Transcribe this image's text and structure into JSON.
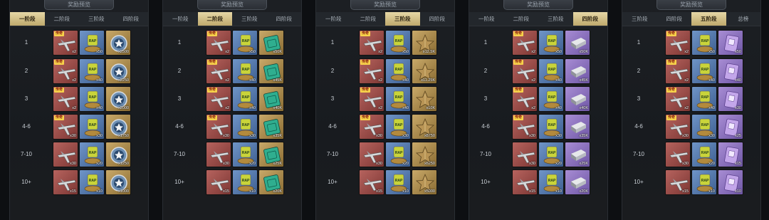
{
  "panels": [
    {
      "title": "奖励预览",
      "tabs": [
        {
          "label": "一阶段",
          "active": true
        },
        {
          "label": "二阶段",
          "active": false
        },
        {
          "label": "三阶段",
          "active": false
        },
        {
          "label": "四阶段",
          "active": false
        }
      ],
      "rows": [
        {
          "tier": "1",
          "items": [
            {
              "type": "plane",
              "quality": "red",
              "badge": "传奇",
              "count": "x2"
            },
            {
              "type": "rations",
              "quality": "blue",
              "count": "x50"
            },
            {
              "type": "medal",
              "quality": "gold",
              "count": "x2500"
            }
          ]
        },
        {
          "tier": "2",
          "items": [
            {
              "type": "plane",
              "quality": "red",
              "badge": "传奇",
              "count": "x2"
            },
            {
              "type": "rations",
              "quality": "blue",
              "count": "x40"
            },
            {
              "type": "medal",
              "quality": "gold",
              "count": "x2250"
            }
          ]
        },
        {
          "tier": "3",
          "items": [
            {
              "type": "plane",
              "quality": "red",
              "badge": "传奇",
              "count": "x2"
            },
            {
              "type": "rations",
              "quality": "blue",
              "count": "x40"
            },
            {
              "type": "medal",
              "quality": "gold",
              "count": "x2000"
            }
          ]
        },
        {
          "tier": "4-6",
          "items": [
            {
              "type": "plane",
              "quality": "red",
              "badge": "传奇",
              "count": "x30"
            },
            {
              "type": "rations",
              "quality": "blue",
              "count": "x30"
            },
            {
              "type": "medal",
              "quality": "gold",
              "count": "x1750"
            }
          ]
        },
        {
          "tier": "7-10",
          "items": [
            {
              "type": "plane",
              "quality": "red",
              "count": "x30"
            },
            {
              "type": "rations",
              "quality": "blue",
              "count": "x20"
            },
            {
              "type": "medal",
              "quality": "gold",
              "count": "x1250"
            }
          ]
        },
        {
          "tier": "10+",
          "items": [
            {
              "type": "plane",
              "quality": "red",
              "count": "x15"
            },
            {
              "type": "rations",
              "quality": "blue",
              "count": "x10"
            },
            {
              "type": "medal",
              "quality": "gold",
              "count": "x1000"
            }
          ]
        }
      ]
    },
    {
      "title": "奖励预览",
      "tabs": [
        {
          "label": "一阶段",
          "active": false
        },
        {
          "label": "二阶段",
          "active": true
        },
        {
          "label": "三阶段",
          "active": false
        },
        {
          "label": "四阶段",
          "active": false
        }
      ],
      "rows": [
        {
          "tier": "1",
          "items": [
            {
              "type": "plane",
              "quality": "red",
              "badge": "传奇",
              "count": "x2"
            },
            {
              "type": "rations",
              "quality": "blue",
              "count": "x50"
            },
            {
              "type": "manual",
              "quality": "gold",
              "count": "x50K"
            }
          ]
        },
        {
          "tier": "2",
          "items": [
            {
              "type": "plane",
              "quality": "red",
              "badge": "传奇",
              "count": "x2"
            },
            {
              "type": "rations",
              "quality": "blue",
              "count": "x40"
            },
            {
              "type": "manual",
              "quality": "gold",
              "count": "x45K"
            }
          ]
        },
        {
          "tier": "3",
          "items": [
            {
              "type": "plane",
              "quality": "red",
              "badge": "传奇",
              "count": "x2"
            },
            {
              "type": "rations",
              "quality": "blue",
              "count": "x40"
            },
            {
              "type": "manual",
              "quality": "gold",
              "count": "x40K"
            }
          ]
        },
        {
          "tier": "4-6",
          "items": [
            {
              "type": "plane",
              "quality": "red",
              "badge": "传奇",
              "count": "x30"
            },
            {
              "type": "rations",
              "quality": "blue",
              "count": "x30"
            },
            {
              "type": "manual",
              "quality": "gold",
              "count": "x35K"
            }
          ]
        },
        {
          "tier": "7-10",
          "items": [
            {
              "type": "plane",
              "quality": "red",
              "count": "x30"
            },
            {
              "type": "rations",
              "quality": "blue",
              "count": "x20"
            },
            {
              "type": "manual",
              "quality": "gold",
              "count": "x25K"
            }
          ]
        },
        {
          "tier": "10+",
          "items": [
            {
              "type": "plane",
              "quality": "red",
              "count": "x15"
            },
            {
              "type": "rations",
              "quality": "blue",
              "count": "x10"
            },
            {
              "type": "manual",
              "quality": "gold",
              "count": "x20K"
            }
          ]
        }
      ]
    },
    {
      "title": "奖励预览",
      "tabs": [
        {
          "label": "一阶段",
          "active": false
        },
        {
          "label": "二阶段",
          "active": false
        },
        {
          "label": "三阶段",
          "active": true
        },
        {
          "label": "四阶段",
          "active": false
        }
      ],
      "rows": [
        {
          "tier": "1",
          "items": [
            {
              "type": "plane",
              "quality": "red",
              "badge": "传奇",
              "count": "x2"
            },
            {
              "type": "rations",
              "quality": "blue",
              "count": "x50"
            },
            {
              "type": "star",
              "quality": "gold",
              "count": "x12.5K"
            }
          ]
        },
        {
          "tier": "2",
          "items": [
            {
              "type": "plane",
              "quality": "red",
              "badge": "传奇",
              "count": "x2"
            },
            {
              "type": "rations",
              "quality": "blue",
              "count": "x40"
            },
            {
              "type": "star",
              "quality": "gold",
              "count": "x11.25K"
            }
          ]
        },
        {
          "tier": "3",
          "items": [
            {
              "type": "plane",
              "quality": "red",
              "badge": "传奇",
              "count": "x2"
            },
            {
              "type": "rations",
              "quality": "blue",
              "count": "x40"
            },
            {
              "type": "star",
              "quality": "gold",
              "count": "x10K"
            }
          ]
        },
        {
          "tier": "4-6",
          "items": [
            {
              "type": "plane",
              "quality": "red",
              "badge": "传奇",
              "count": "x30"
            },
            {
              "type": "rations",
              "quality": "blue",
              "count": "x30"
            },
            {
              "type": "star",
              "quality": "gold",
              "count": "x8750"
            }
          ]
        },
        {
          "tier": "7-10",
          "items": [
            {
              "type": "plane",
              "quality": "red",
              "count": "x30"
            },
            {
              "type": "rations",
              "quality": "blue",
              "count": "x20"
            },
            {
              "type": "star",
              "quality": "gold",
              "count": "x6250"
            }
          ]
        },
        {
          "tier": "10+",
          "items": [
            {
              "type": "plane",
              "quality": "red",
              "count": "x15"
            },
            {
              "type": "rations",
              "quality": "blue",
              "count": "x10"
            },
            {
              "type": "star",
              "quality": "gold",
              "count": "x5000"
            }
          ]
        }
      ]
    },
    {
      "title": "奖励预览",
      "tabs": [
        {
          "label": "一阶段",
          "active": false
        },
        {
          "label": "二阶段",
          "active": false
        },
        {
          "label": "三阶段",
          "active": false
        },
        {
          "label": "四阶段",
          "active": true
        }
      ],
      "rows": [
        {
          "tier": "1",
          "items": [
            {
              "type": "plane",
              "quality": "red",
              "badge": "传奇",
              "count": "x2"
            },
            {
              "type": "rations",
              "quality": "blue",
              "count": "x50"
            },
            {
              "type": "steel",
              "quality": "purple",
              "count": "x50K"
            }
          ]
        },
        {
          "tier": "2",
          "items": [
            {
              "type": "plane",
              "quality": "red",
              "badge": "传奇",
              "count": "x2"
            },
            {
              "type": "rations",
              "quality": "blue",
              "count": "x40"
            },
            {
              "type": "steel",
              "quality": "purple",
              "count": "x45K"
            }
          ]
        },
        {
          "tier": "3",
          "items": [
            {
              "type": "plane",
              "quality": "red",
              "badge": "传奇",
              "count": "x2"
            },
            {
              "type": "rations",
              "quality": "blue",
              "count": "x40"
            },
            {
              "type": "steel",
              "quality": "purple",
              "count": "x40K"
            }
          ]
        },
        {
          "tier": "4-6",
          "items": [
            {
              "type": "plane",
              "quality": "red",
              "badge": "传奇",
              "count": "x30"
            },
            {
              "type": "rations",
              "quality": "blue",
              "count": "x30"
            },
            {
              "type": "steel",
              "quality": "purple",
              "count": "x35K"
            }
          ]
        },
        {
          "tier": "7-10",
          "items": [
            {
              "type": "plane",
              "quality": "red",
              "count": "x30"
            },
            {
              "type": "rations",
              "quality": "blue",
              "count": "x20"
            },
            {
              "type": "steel",
              "quality": "purple",
              "count": "x25K"
            }
          ]
        },
        {
          "tier": "10+",
          "items": [
            {
              "type": "plane",
              "quality": "red",
              "count": "x15"
            },
            {
              "type": "rations",
              "quality": "blue",
              "count": "x10"
            },
            {
              "type": "steel",
              "quality": "purple",
              "count": "x20K"
            }
          ]
        }
      ]
    },
    {
      "title": "奖励预览",
      "tabs": [
        {
          "label": "三阶段",
          "active": false
        },
        {
          "label": "四阶段",
          "active": false
        },
        {
          "label": "五阶段",
          "active": true
        },
        {
          "label": "总榜",
          "active": false
        }
      ],
      "rows": [
        {
          "tier": "1",
          "items": [
            {
              "type": "plane",
              "quality": "red",
              "badge": "传奇",
              "count": "x2"
            },
            {
              "type": "rations",
              "quality": "blue",
              "count": "x50"
            },
            {
              "type": "book",
              "quality": "purple",
              "count": "x50"
            }
          ]
        },
        {
          "tier": "2",
          "items": [
            {
              "type": "plane",
              "quality": "red",
              "badge": "传奇",
              "count": "x2"
            },
            {
              "type": "rations",
              "quality": "blue",
              "count": "x40"
            },
            {
              "type": "book",
              "quality": "purple",
              "count": "x40"
            }
          ]
        },
        {
          "tier": "3",
          "items": [
            {
              "type": "plane",
              "quality": "red",
              "badge": "传奇",
              "count": "x2"
            },
            {
              "type": "rations",
              "quality": "blue",
              "count": "x40"
            },
            {
              "type": "book",
              "quality": "purple",
              "count": "x30"
            }
          ]
        },
        {
          "tier": "4-6",
          "items": [
            {
              "type": "plane",
              "quality": "red",
              "badge": "传奇",
              "count": "x30"
            },
            {
              "type": "rations",
              "quality": "blue",
              "count": "x30"
            },
            {
              "type": "book",
              "quality": "purple",
              "count": "x25"
            }
          ]
        },
        {
          "tier": "7-10",
          "items": [
            {
              "type": "plane",
              "quality": "red",
              "count": "x30"
            },
            {
              "type": "rations",
              "quality": "blue",
              "count": "x20"
            },
            {
              "type": "book",
              "quality": "purple",
              "count": "x15"
            }
          ]
        },
        {
          "tier": "10+",
          "items": [
            {
              "type": "plane",
              "quality": "red",
              "count": "x15"
            },
            {
              "type": "rations",
              "quality": "blue",
              "count": "x10"
            },
            {
              "type": "book",
              "quality": "purple",
              "count": "x10"
            }
          ]
        }
      ]
    }
  ]
}
